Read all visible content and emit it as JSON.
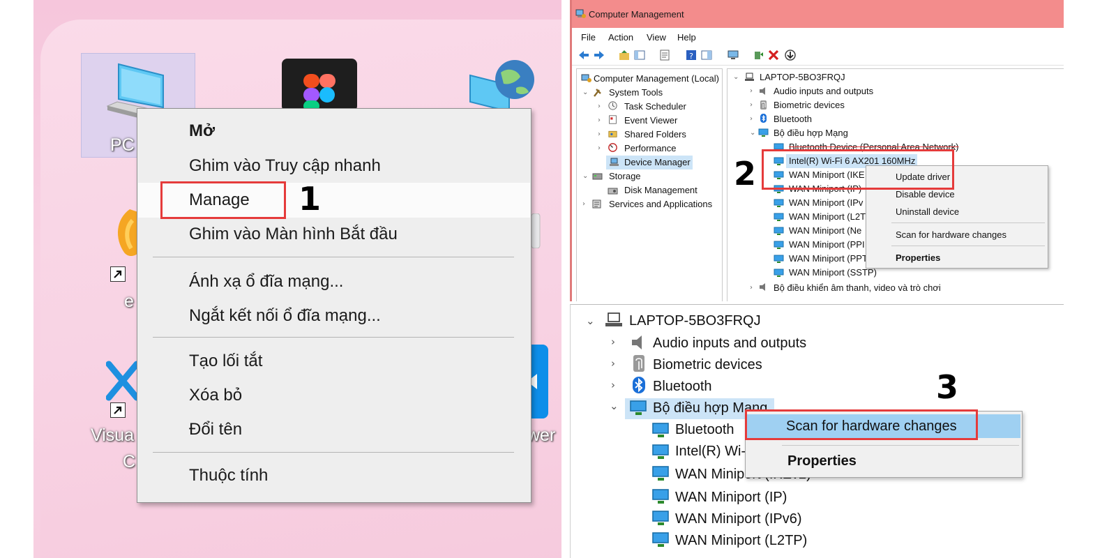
{
  "desktop": {
    "icons": {
      "this_pc_label": "PC",
      "row2_left_label": "e",
      "row3_left_label_1": "Visua",
      "row3_left_label_2": "C",
      "row3_right_label": "wer"
    }
  },
  "context_menu": {
    "items": [
      {
        "label": "Mở",
        "bold": true
      },
      {
        "label": "Ghim vào Truy cập nhanh"
      },
      {
        "label": "Manage",
        "highlighted": true
      },
      {
        "label": "Ghim vào Màn hình Bắt đầu"
      },
      {
        "label": "Ánh xạ ổ đĩa mạng..."
      },
      {
        "label": "Ngắt kết nối ổ đĩa mạng..."
      },
      {
        "label": "Tạo lối tắt"
      },
      {
        "label": "Xóa bỏ"
      },
      {
        "label": "Đổi tên"
      },
      {
        "label": "Thuộc tính"
      }
    ]
  },
  "steps": [
    "1",
    "2",
    "3"
  ],
  "computer_management": {
    "title": "Computer Management",
    "menu": [
      "File",
      "Action",
      "View",
      "Help"
    ],
    "left_tree": [
      "Computer Management (Local)",
      "System Tools",
      "Task Scheduler",
      "Event Viewer",
      "Shared Folders",
      "Performance",
      "Device Manager",
      "Storage",
      "Disk Management",
      "Services and Applications"
    ],
    "device_tree": {
      "root": "LAPTOP-5BO3FRQJ",
      "categories": [
        "Audio inputs and outputs",
        "Biometric devices",
        "Bluetooth",
        "Bộ điều hợp Mạng"
      ],
      "network_adapters": [
        "Bluetooth Device (Personal Area Network)",
        "Intel(R) Wi-Fi 6 AX201 160MHz",
        "WAN Miniport (IKE",
        "WAN Miniport (IP)",
        "WAN Miniport (IPv",
        "WAN Miniport (L2T",
        "WAN Miniport (Ne",
        "WAN Miniport (PPI",
        "WAN Miniport (PPT",
        "WAN Miniport (SSTP)"
      ],
      "after": "Bộ điều khiển âm thanh, video và trò chơi"
    },
    "context_menu": [
      "Update driver",
      "Disable device",
      "Uninstall device",
      "Scan for hardware changes",
      "Properties"
    ]
  },
  "zoom_panel": {
    "root": "LAPTOP-5BO3FRQJ",
    "categories": [
      "Audio inputs and outputs",
      "Biometric devices",
      "Bluetooth",
      "Bộ điều hợp Mang"
    ],
    "adapters": [
      "Bluetooth",
      "Intel(R) Wi-",
      "WAN Miniport (IKEv2)",
      "WAN Miniport (IP)",
      "WAN Miniport (IPv6)",
      "WAN Miniport (L2TP)"
    ],
    "context_menu": [
      "Scan for hardware changes",
      "Properties"
    ]
  },
  "colors": {
    "highlight_box": "#e53b3b",
    "title_bar": "#f38c8c",
    "selection": "#cce4f7"
  }
}
